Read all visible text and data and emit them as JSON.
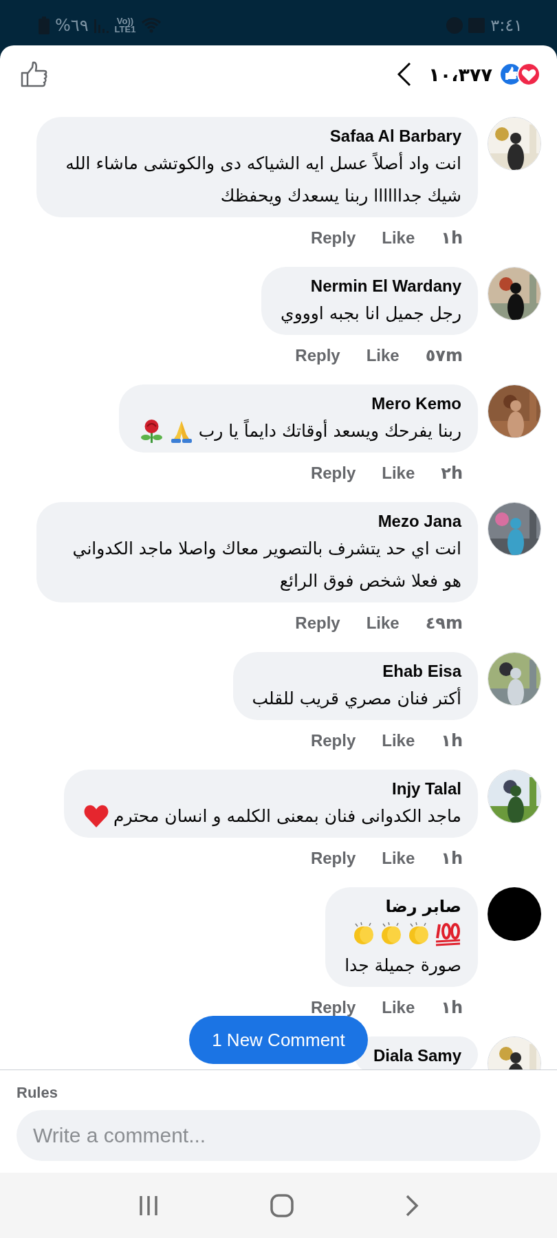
{
  "status_bar": {
    "battery": "%٦٩",
    "network_top": "Vo))",
    "network_bottom": "LTE1",
    "time": "٣:٤١"
  },
  "header": {
    "reaction_count": "١٠،٣٧٧"
  },
  "comments": [
    {
      "author": "Safaa Al Barbary",
      "text": "انت واد أصلاً عسل ايه الشياكه دى والكوتشى ماشاء الله شيك جداااااا ربنا يسعدك ويحفظك",
      "reply": "Reply",
      "like": "Like",
      "time": "١h",
      "avatar": {
        "kind": "picture"
      }
    },
    {
      "author": "Nermin El Wardany",
      "text": "رجل جميل انا بجبه اوووي",
      "reply": "Reply",
      "like": "Like",
      "time": "٥٧m",
      "avatar": {
        "kind": "picture"
      }
    },
    {
      "author": "Mero Kemo",
      "text": "ربنا يفرحك ويسعد أوقاتك دايماً يا رب",
      "emojis_after": [
        {
          "kind": "pray"
        },
        {
          "kind": "rose"
        }
      ],
      "reply": "Reply",
      "like": "Like",
      "time": "٢h",
      "avatar": {
        "kind": "picture"
      }
    },
    {
      "author": "Mezo Jana",
      "text": "انت اي حد يتشرف بالتصوير معاك واصلا ماجد الكدواني هو فعلا شخص فوق الرائع",
      "reply": "Reply",
      "like": "Like",
      "time": "٤٩m",
      "avatar": {
        "kind": "picture"
      }
    },
    {
      "author": "Ehab Eisa",
      "text": "أكتر فنان مصري قريب للقلب",
      "reply": "Reply",
      "like": "Like",
      "time": "١h",
      "avatar": {
        "kind": "picture"
      }
    },
    {
      "author": "Injy Talal",
      "text": "ماجد الكدوانى فنان بمعنى الكلمه و انسان محترم",
      "emojis_after": [
        {
          "kind": "heart"
        }
      ],
      "reply": "Reply",
      "like": "Like",
      "time": "١h",
      "avatar": {
        "kind": "picture"
      }
    },
    {
      "author": "صابر رضا",
      "emojis_before": [
        {
          "kind": "hundred"
        },
        {
          "kind": "clap"
        },
        {
          "kind": "clap"
        },
        {
          "kind": "clap"
        }
      ],
      "text": "صورة جميلة جدا",
      "reply": "Reply",
      "like": "Like",
      "time": "١h",
      "avatar": {
        "kind": "plain"
      }
    },
    {
      "author": "Diala Samy",
      "avatar": {
        "kind": "picture"
      }
    }
  ],
  "new_comment_pill": "1 New Comment",
  "composer": {
    "rules": "Rules",
    "placeholder": "Write a comment..."
  }
}
